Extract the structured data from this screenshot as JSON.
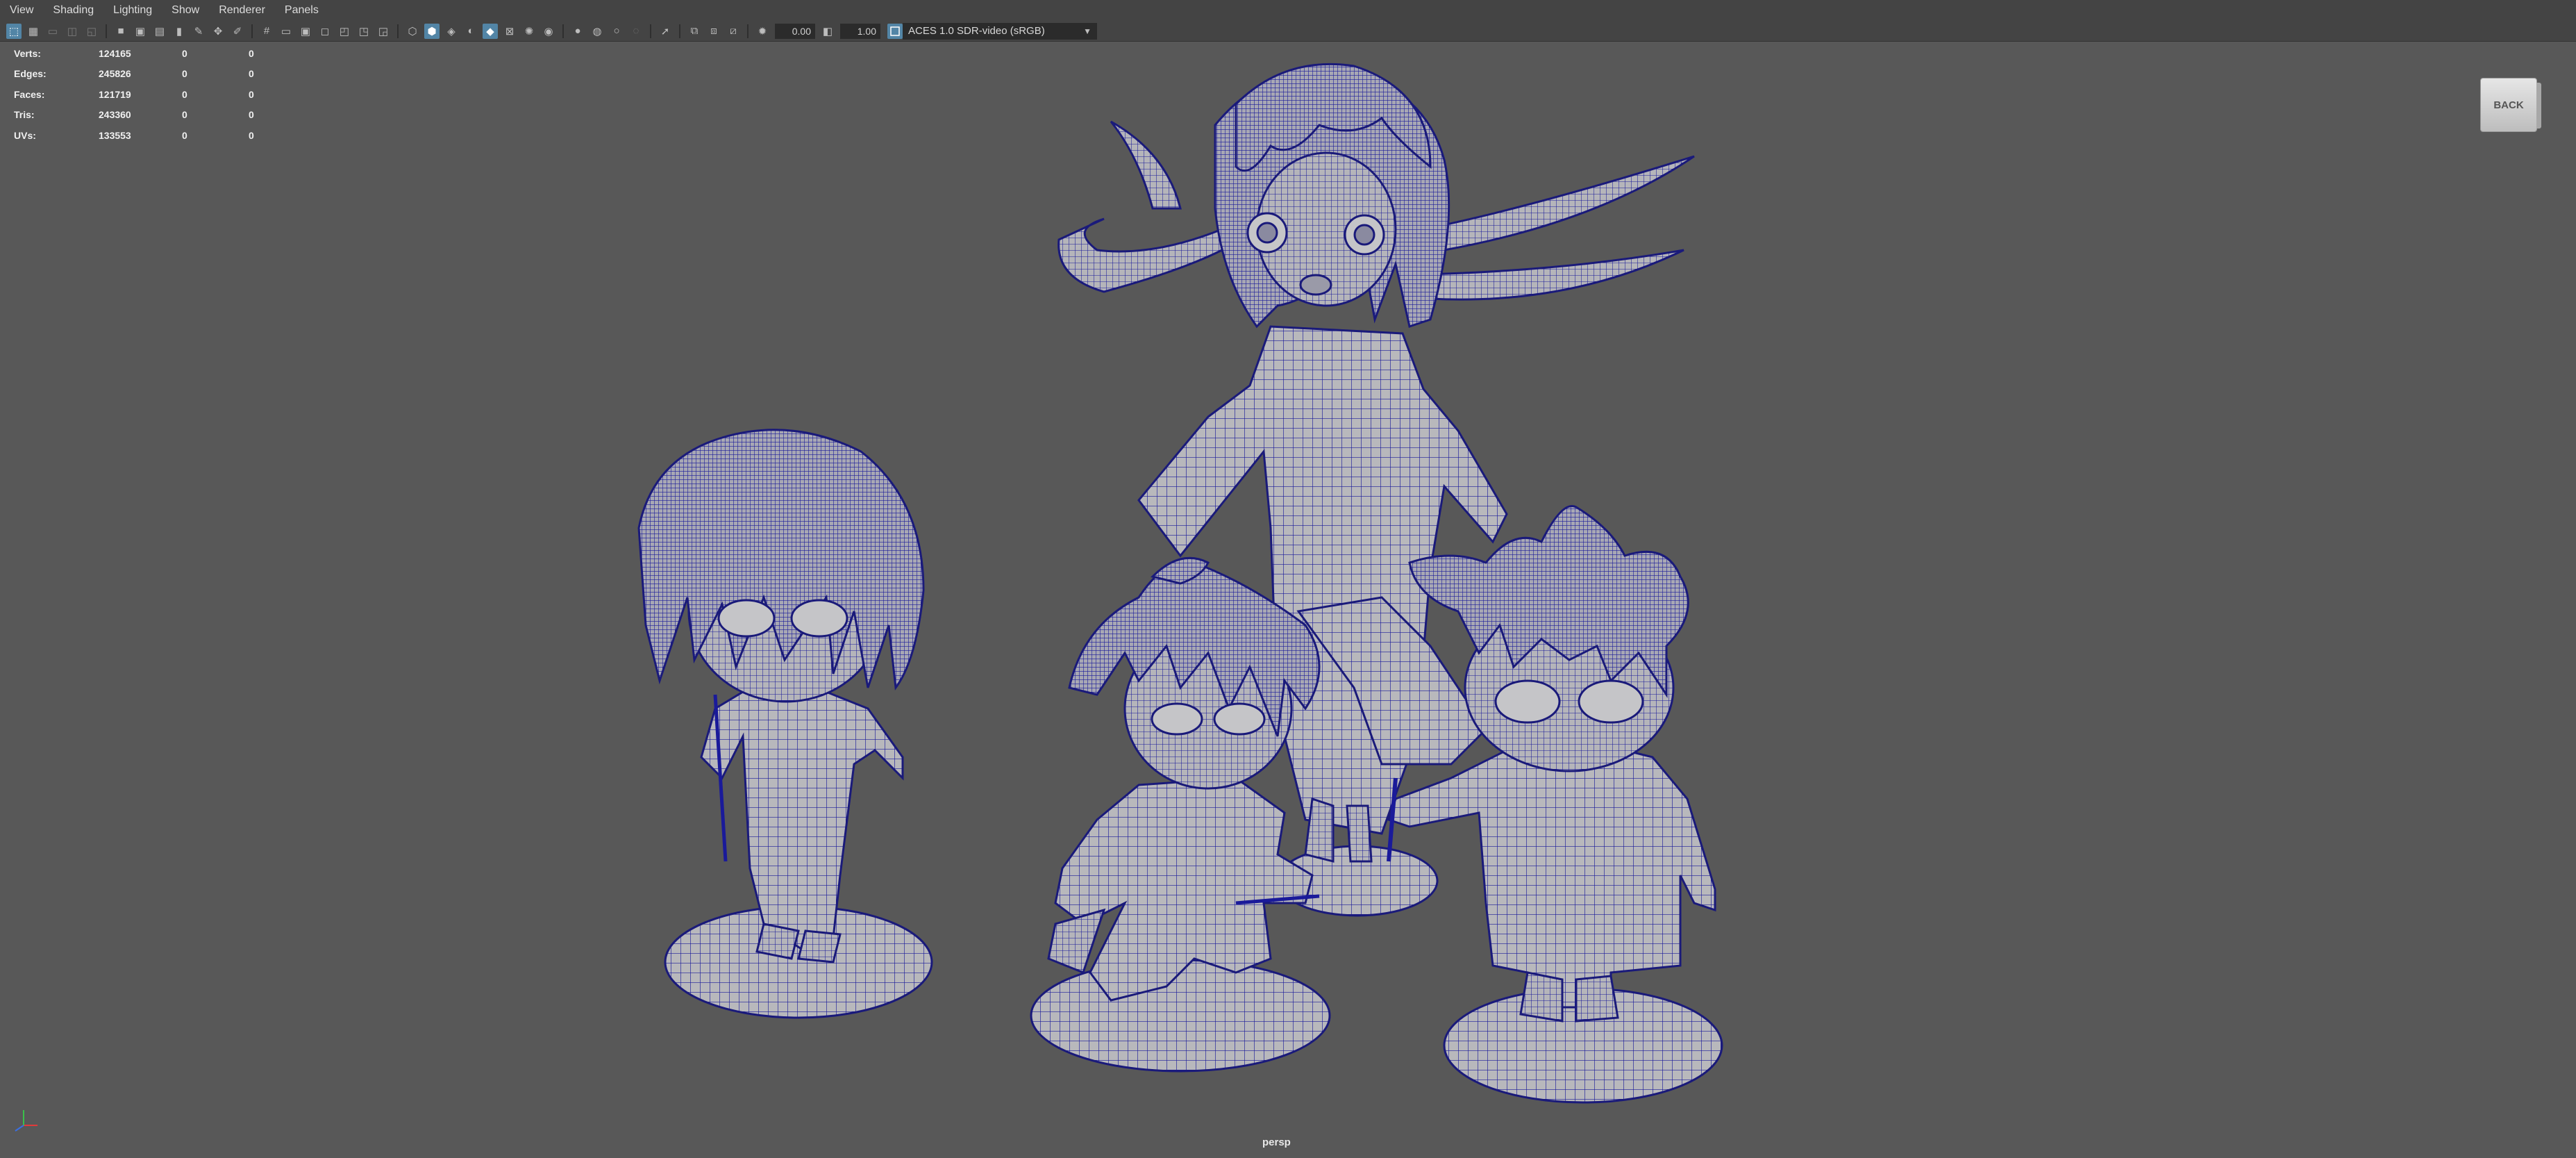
{
  "menu": [
    "View",
    "Shading",
    "Lighting",
    "Show",
    "Renderer",
    "Panels"
  ],
  "toolbar": {
    "camera_near_value": "0.00",
    "camera_far_value": "1.00",
    "color_space": "ACES 1.0 SDR-video (sRGB)"
  },
  "hud": {
    "rows": [
      {
        "label": "Verts:",
        "value": "124165",
        "c2": "0",
        "c3": "0"
      },
      {
        "label": "Edges:",
        "value": "245826",
        "c2": "0",
        "c3": "0"
      },
      {
        "label": "Faces:",
        "value": "121719",
        "c2": "0",
        "c3": "0"
      },
      {
        "label": "Tris:",
        "value": "243360",
        "c2": "0",
        "c3": "0"
      },
      {
        "label": "UVs:",
        "value": "133553",
        "c2": "0",
        "c3": "0"
      }
    ]
  },
  "viewcube_label": "BACK",
  "camera_name": "persp",
  "colors": {
    "viewport_bg": "#585858",
    "mesh_fill": "#b8b8bc",
    "wireframe": "#1a1a9a",
    "accent": "#5285a6"
  }
}
